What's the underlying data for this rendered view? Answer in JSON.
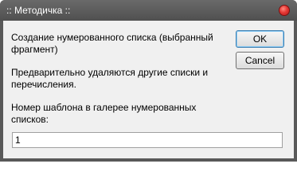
{
  "window": {
    "title": ":: Методичка ::"
  },
  "dialog": {
    "line1": "Создание нумерованного списка (выбранный",
    "line2": "фрагмент)",
    "line3": "Предварительно удаляются другие списки и",
    "line4": "перечисления.",
    "line5": "Номер шаблона в галерее нумерованных",
    "line6": "списков:",
    "template_number_value": "1"
  },
  "buttons": {
    "ok_label": "OK",
    "cancel_label": "Cancel"
  },
  "colors": {
    "titlebar": "#595959",
    "client": "#f0f0f0",
    "close_button": "#e53935"
  }
}
